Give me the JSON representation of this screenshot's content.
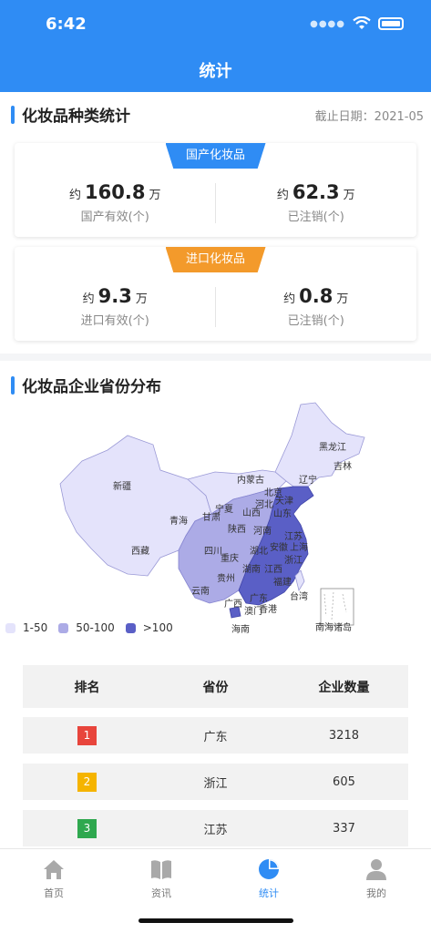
{
  "status_bar": {
    "time": "6:42"
  },
  "nav": {
    "title": "统计"
  },
  "types_section": {
    "title": "化妆品种类统计",
    "cutoff": "截止日期：2021-05",
    "domestic": {
      "tag": "国产化妆品",
      "tag_color": "#2f8cf4",
      "valid": {
        "prefix": "约",
        "value": "160.8",
        "unit": "万",
        "label": "国产有效(个)"
      },
      "cancelled": {
        "prefix": "约",
        "value": "62.3",
        "unit": "万",
        "label": "已注销(个)"
      }
    },
    "imported": {
      "tag": "进口化妆品",
      "tag_color": "#f39a2b",
      "valid": {
        "prefix": "约",
        "value": "9.3",
        "unit": "万",
        "label": "进口有效(个)"
      },
      "cancelled": {
        "prefix": "约",
        "value": "0.8",
        "unit": "万",
        "label": "已注销(个)"
      }
    }
  },
  "province_section": {
    "title": "化妆品企业省份分布",
    "legend": [
      {
        "label": "1-50",
        "color": "#e4e3fb"
      },
      {
        "label": "50-100",
        "color": "#acabe6"
      },
      {
        "label": ">100",
        "color": "#5a5fc6"
      }
    ],
    "map_labels": {
      "heilongjiang": "黑龙江",
      "jilin": "吉林",
      "liaoning": "辽宁",
      "neimenggu": "内蒙古",
      "xinjiang": "新疆",
      "xizang": "西藏",
      "qinghai": "青海",
      "gansu": "甘肃",
      "ningxia": "宁夏",
      "beijing": "北京",
      "tianjin": "天津",
      "hebei": "河北",
      "shanxi": "山西",
      "shandong": "山东",
      "shaanxi": "陕西",
      "henan": "河南",
      "jiangsu": "江苏",
      "anhui": "安徽",
      "shanghai": "上海",
      "sichuan": "四川",
      "chongqing": "重庆",
      "hubei": "湖北",
      "zhejiang": "浙江",
      "hunan": "湖南",
      "jiangxi": "江西",
      "guizhou": "贵州",
      "yunnan": "云南",
      "fujian": "福建",
      "guangxi": "广西",
      "guangdong": "广东",
      "aomen": "澳门",
      "xianggang": "香港",
      "taiwan": "台湾",
      "hainan": "海南",
      "nanhai": "南海诸岛"
    }
  },
  "ranking_table": {
    "headers": [
      "排名",
      "省份",
      "企业数量"
    ],
    "rows": [
      {
        "rank": "1",
        "province": "广东",
        "count": "3218",
        "badge_color": "#e8453c"
      },
      {
        "rank": "2",
        "province": "浙江",
        "count": "605",
        "badge_color": "#f5b400"
      },
      {
        "rank": "3",
        "province": "江苏",
        "count": "337",
        "badge_color": "#2fa84f"
      }
    ]
  },
  "tabbar": {
    "items": [
      {
        "label": "首页",
        "icon": "home-icon"
      },
      {
        "label": "资讯",
        "icon": "book-icon"
      },
      {
        "label": "统计",
        "icon": "pie-chart-icon"
      },
      {
        "label": "我的",
        "icon": "user-icon"
      }
    ],
    "active_color": "#2f8cf4"
  }
}
